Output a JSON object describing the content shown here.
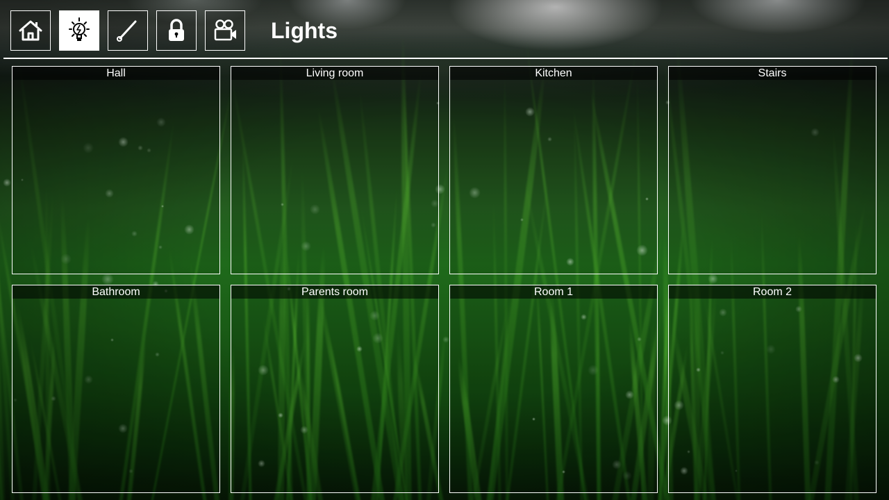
{
  "page": {
    "title": "Lights"
  },
  "nav": {
    "items": [
      {
        "name": "home",
        "icon": "home-icon",
        "active": false
      },
      {
        "name": "lights",
        "icon": "lightbulb-icon",
        "active": true
      },
      {
        "name": "blinds",
        "icon": "wand-icon",
        "active": false
      },
      {
        "name": "security",
        "icon": "lock-icon",
        "active": false
      },
      {
        "name": "cameras",
        "icon": "video-camera-icon",
        "active": false
      }
    ]
  },
  "rooms": [
    {
      "label": "Hall"
    },
    {
      "label": "Living room"
    },
    {
      "label": "Kitchen"
    },
    {
      "label": "Stairs"
    },
    {
      "label": "Bathroom"
    },
    {
      "label": "Parents room"
    },
    {
      "label": "Room 1"
    },
    {
      "label": "Room 2"
    }
  ],
  "colors": {
    "foreground": "#ffffff",
    "active_nav_background": "#ffffff",
    "active_nav_icon": "#000000"
  }
}
